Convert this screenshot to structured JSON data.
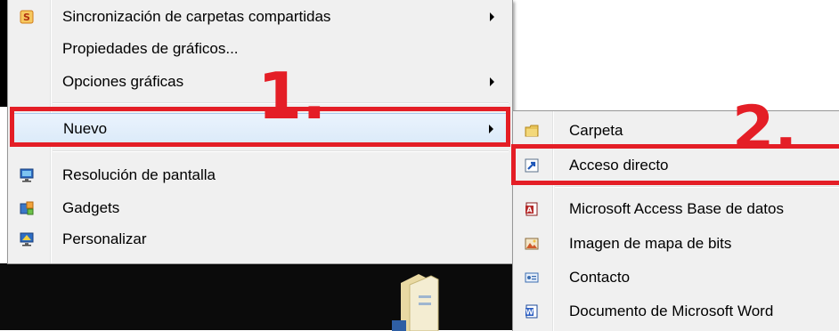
{
  "main_menu": {
    "items": [
      {
        "label": "Sincronización de carpetas compartidas",
        "icon": "sync-share-icon",
        "has_submenu": true
      },
      {
        "label": "Propiedades de gráficos...",
        "icon": "",
        "has_submenu": false
      },
      {
        "label": "Opciones gráficas",
        "icon": "",
        "has_submenu": true
      },
      {
        "label": "Nuevo",
        "icon": "",
        "has_submenu": true
      },
      {
        "label": "Resolución de pantalla",
        "icon": "screen-resolution-icon",
        "has_submenu": false
      },
      {
        "label": "Gadgets",
        "icon": "gadgets-icon",
        "has_submenu": false
      },
      {
        "label": "Personalizar",
        "icon": "personalize-icon",
        "has_submenu": false
      }
    ]
  },
  "sub_menu": {
    "items": [
      {
        "label": "Carpeta",
        "icon": "folder-icon"
      },
      {
        "label": "Acceso directo",
        "icon": "shortcut-icon"
      },
      {
        "label": "Microsoft Access Base de datos",
        "icon": "access-database-icon"
      },
      {
        "label": "Imagen de mapa de bits",
        "icon": "bitmap-image-icon"
      },
      {
        "label": "Contacto",
        "icon": "contact-icon"
      },
      {
        "label": "Documento de Microsoft Word",
        "icon": "word-document-icon"
      }
    ]
  },
  "annotations": {
    "step1": "1.",
    "step2": "2.",
    "color": "#e41e26"
  }
}
